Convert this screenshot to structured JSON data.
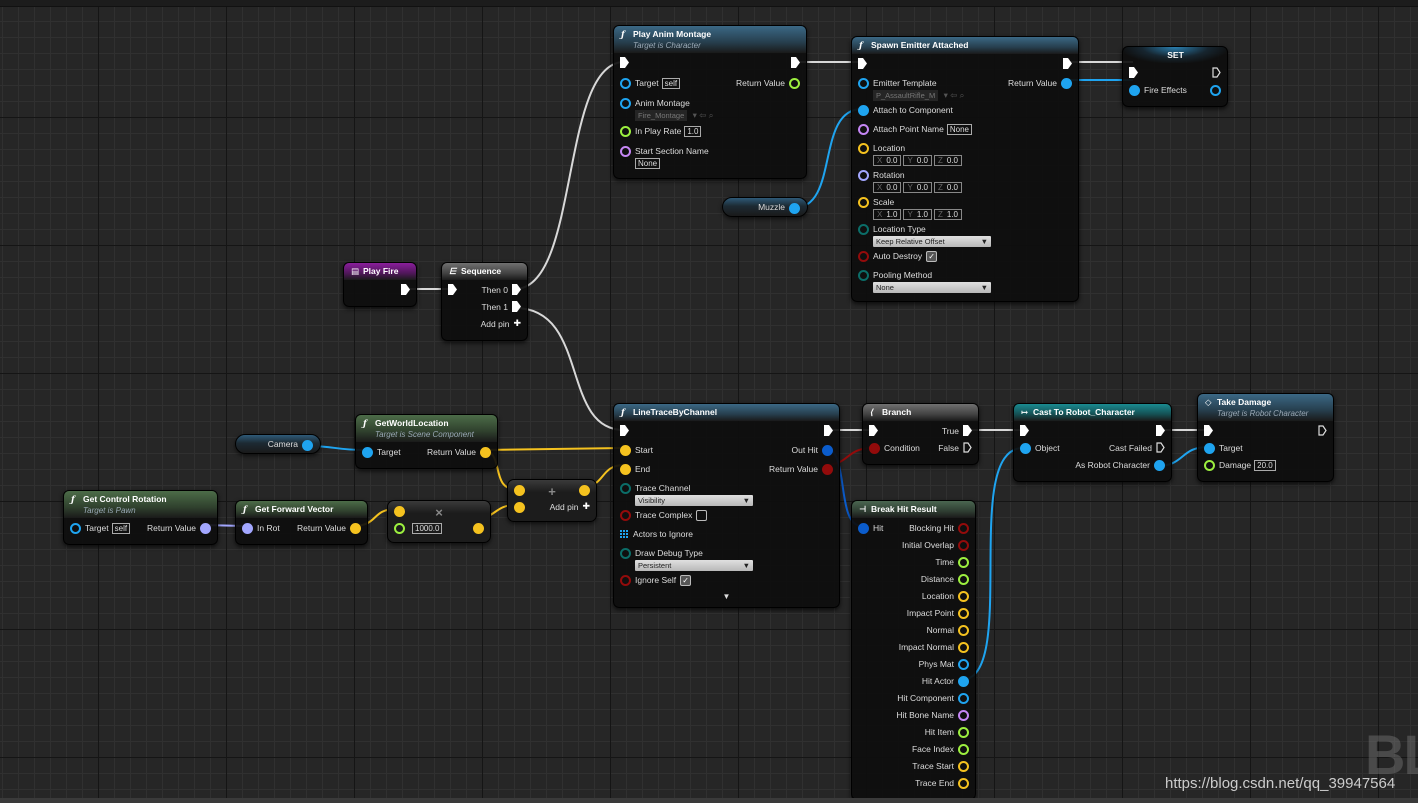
{
  "pin_colors": {
    "exec": "#ffffff",
    "object": "#1fa4f0",
    "vector": "#f5c21f",
    "float": "#9cef3f",
    "bool": "#930b0b",
    "name": "#c586f5",
    "byte": "#0b6d68",
    "rotator": "#a3a7ff",
    "struct": "#0b5ccc",
    "array": "#1fa4f0"
  },
  "header_colors": {
    "function": "#3b6885",
    "pure": "#4c6c48",
    "event": "#8a1e9c",
    "macro": "#707070",
    "cast": "#1a8a90",
    "break": "#4a6650"
  },
  "nodes": {
    "play_fire": {
      "style": "event",
      "icon": "event-icon",
      "title": "Play Fire",
      "rows": [
        {
          "r": {
            "t": "exec",
            "c": true
          }
        }
      ]
    },
    "sequence": {
      "style": "macro",
      "icon": "sequence-icon",
      "title": "Sequence",
      "rows": [
        {
          "l": {
            "t": "exec",
            "c": true
          },
          "r": {
            "t": "exec",
            "c": true,
            "label": "Then 0"
          }
        },
        {
          "r": {
            "t": "exec",
            "c": true,
            "label": "Then 1"
          }
        },
        {
          "r": {
            "t": "plus",
            "label": "Add pin"
          }
        }
      ]
    },
    "play_anim_montage": {
      "style": "function",
      "icon": "function-icon",
      "title": "Play Anim Montage",
      "subtitle": "Target is Character",
      "rows": [
        {
          "l": {
            "t": "exec",
            "c": true
          },
          "r": {
            "t": "exec",
            "c": true
          }
        },
        {
          "l": {
            "t": "object",
            "label": "Target",
            "value": "self"
          },
          "r": {
            "t": "float",
            "label": "Return Value"
          }
        },
        {
          "l": {
            "t": "object",
            "label": "Anim Montage",
            "asset": "Fire_Montage"
          }
        },
        {
          "l": {
            "t": "float",
            "label": "In Play Rate",
            "value": "1.0"
          }
        },
        {
          "l": {
            "t": "name",
            "label": "Start Section Name",
            "below": "None"
          }
        }
      ]
    },
    "spawn_emitter": {
      "style": "function",
      "icon": "function-icon",
      "title": "Spawn Emitter Attached",
      "rows": [
        {
          "l": {
            "t": "exec",
            "c": true
          },
          "r": {
            "t": "exec",
            "c": true
          }
        },
        {
          "l": {
            "t": "object",
            "label": "Emitter Template",
            "asset": "P_AssaultRifle_M"
          },
          "r": {
            "t": "object",
            "c": true,
            "label": "Return Value"
          }
        },
        {
          "l": {
            "t": "object",
            "c": true,
            "label": "Attach to Component"
          }
        },
        {
          "l": {
            "t": "name",
            "label": "Attach Point Name",
            "value": "None"
          }
        },
        {
          "l": {
            "t": "vector",
            "label": "Location",
            "vec": [
              [
                "X",
                "0.0"
              ],
              [
                "Y",
                "0.0"
              ],
              [
                "Z",
                "0.0"
              ]
            ]
          }
        },
        {
          "l": {
            "t": "rotator",
            "label": "Rotation",
            "vec": [
              [
                "X",
                "0.0"
              ],
              [
                "Y",
                "0.0"
              ],
              [
                "Z",
                "0.0"
              ]
            ]
          }
        },
        {
          "l": {
            "t": "vector",
            "label": "Scale",
            "vec": [
              [
                "X",
                "1.0"
              ],
              [
                "Y",
                "1.0"
              ],
              [
                "Z",
                "1.0"
              ]
            ]
          }
        },
        {
          "l": {
            "t": "byte",
            "label": "Location Type",
            "dropdown": "Keep Relative Offset"
          }
        },
        {
          "l": {
            "t": "bool",
            "label": "Auto Destroy",
            "check": true
          }
        },
        {
          "l": {
            "t": "byte",
            "label": "Pooling Method",
            "dropdown": "None"
          }
        }
      ]
    },
    "set_fire_effects": {
      "style": "set",
      "title": "SET",
      "rows": [
        {
          "l": {
            "t": "exec",
            "c": true
          },
          "r": {
            "t": "exec"
          }
        },
        {
          "l": {
            "t": "object",
            "c": true,
            "label": "Fire Effects"
          },
          "r": {
            "t": "object"
          }
        }
      ]
    },
    "muzzle": {
      "style": "getter",
      "label": "Muzzle",
      "pin": "object"
    },
    "camera": {
      "style": "getter",
      "label": "Camera",
      "pin": "object"
    },
    "line_trace": {
      "style": "function",
      "icon": "function-icon",
      "title": "LineTraceByChannel",
      "rows": [
        {
          "l": {
            "t": "exec",
            "c": true
          },
          "r": {
            "t": "exec",
            "c": true
          }
        },
        {
          "l": {
            "t": "vector",
            "c": true,
            "label": "Start"
          },
          "r": {
            "t": "struct",
            "c": true,
            "label": "Out Hit"
          }
        },
        {
          "l": {
            "t": "vector",
            "c": true,
            "label": "End"
          },
          "r": {
            "t": "bool",
            "c": true,
            "label": "Return Value"
          }
        },
        {
          "l": {
            "t": "byte",
            "label": "Trace Channel",
            "dropdown": "Visibility"
          }
        },
        {
          "l": {
            "t": "bool",
            "label": "Trace Complex",
            "check": false
          }
        },
        {
          "l": {
            "t": "array",
            "label": "Actors to Ignore"
          }
        },
        {
          "l": {
            "t": "byte",
            "label": "Draw Debug Type",
            "dropdown": "Persistent"
          }
        },
        {
          "l": {
            "t": "bool",
            "label": "Ignore Self",
            "check": true
          }
        }
      ],
      "expand": "▼"
    },
    "branch": {
      "style": "macro",
      "icon": "branch-icon",
      "title": "Branch",
      "rows": [
        {
          "l": {
            "t": "exec",
            "c": true
          },
          "r": {
            "t": "exec",
            "c": true,
            "label": "True"
          }
        },
        {
          "l": {
            "t": "bool",
            "c": true,
            "label": "Condition"
          },
          "r": {
            "t": "exec",
            "label": "False"
          }
        }
      ]
    },
    "cast": {
      "style": "cast",
      "icon": "cast-icon",
      "title": "Cast To Robot_Character",
      "rows": [
        {
          "l": {
            "t": "exec",
            "c": true
          },
          "r": {
            "t": "exec",
            "c": true
          }
        },
        {
          "l": {
            "t": "object",
            "c": true,
            "label": "Object"
          },
          "r": {
            "t": "exec",
            "label": "Cast Failed"
          }
        },
        {
          "r": {
            "t": "object",
            "c": true,
            "label": "As Robot Character"
          }
        }
      ]
    },
    "take_damage": {
      "style": "function",
      "icon": "event-diamond-icon",
      "title": "Take Damage",
      "subtitle": "Target is Robot Character",
      "rows": [
        {
          "l": {
            "t": "exec",
            "c": true
          },
          "r": {
            "t": "exec"
          }
        },
        {
          "l": {
            "t": "object",
            "c": true,
            "label": "Target"
          }
        },
        {
          "l": {
            "t": "float",
            "label": "Damage",
            "value": "20.0"
          }
        }
      ]
    },
    "break_hit": {
      "style": "break",
      "icon": "break-struct-icon",
      "title": "Break Hit Result",
      "rows": [
        {
          "l": {
            "t": "struct",
            "c": true,
            "label": "Hit"
          },
          "r": {
            "t": "bool",
            "label": "Blocking Hit"
          }
        },
        {
          "r": {
            "t": "bool",
            "label": "Initial Overlap"
          }
        },
        {
          "r": {
            "t": "float",
            "label": "Time"
          }
        },
        {
          "r": {
            "t": "float",
            "label": "Distance"
          }
        },
        {
          "r": {
            "t": "vector",
            "label": "Location"
          }
        },
        {
          "r": {
            "t": "vector",
            "label": "Impact Point"
          }
        },
        {
          "r": {
            "t": "vector",
            "label": "Normal"
          }
        },
        {
          "r": {
            "t": "vector",
            "label": "Impact Normal"
          }
        },
        {
          "r": {
            "t": "object",
            "label": "Phys Mat"
          }
        },
        {
          "r": {
            "t": "object",
            "c": true,
            "label": "Hit Actor"
          }
        },
        {
          "r": {
            "t": "object",
            "label": "Hit Component"
          }
        },
        {
          "r": {
            "t": "name",
            "label": "Hit Bone Name"
          }
        },
        {
          "r": {
            "t": "float",
            "label": "Hit Item"
          }
        },
        {
          "r": {
            "t": "float",
            "label": "Face Index"
          }
        },
        {
          "r": {
            "t": "vector",
            "label": "Trace Start"
          }
        },
        {
          "r": {
            "t": "vector",
            "label": "Trace End"
          }
        }
      ]
    },
    "get_world_location": {
      "style": "pure",
      "icon": "function-icon",
      "title": "GetWorldLocation",
      "subtitle": "Target is Scene Component",
      "rows": [
        {
          "l": {
            "t": "object",
            "c": true,
            "label": "Target"
          },
          "r": {
            "t": "vector",
            "c": true,
            "label": "Return Value"
          }
        }
      ]
    },
    "get_control_rotation": {
      "style": "pure",
      "icon": "function-icon",
      "title": "Get Control Rotation",
      "subtitle": "Target is Pawn",
      "rows": [
        {
          "l": {
            "t": "object",
            "label": "Target",
            "value": "self"
          },
          "r": {
            "t": "rotator",
            "c": true,
            "label": "Return Value"
          }
        }
      ]
    },
    "get_forward_vector": {
      "style": "pure",
      "icon": "function-icon",
      "title": "Get Forward Vector",
      "rows": [
        {
          "l": {
            "t": "rotator",
            "c": true,
            "label": "In Rot"
          },
          "r": {
            "t": "vector",
            "c": true,
            "label": "Return Value"
          }
        }
      ]
    },
    "multiply": {
      "style": "compact",
      "symbol": "×",
      "rows": [
        {
          "l": {
            "t": "vector",
            "c": true
          }
        },
        {
          "l": {
            "t": "float",
            "value": "1000.0"
          },
          "r": {
            "t": "vector",
            "c": true
          }
        }
      ]
    },
    "add": {
      "style": "compact",
      "symbol": "+",
      "rows": [
        {
          "l": {
            "t": "vector",
            "c": true
          },
          "r": {
            "t": "vector",
            "c": true
          }
        },
        {
          "l": {
            "t": "vector",
            "c": true
          },
          "r": {
            "t": "plus",
            "label": "Add pin"
          }
        }
      ]
    }
  },
  "watermark": {
    "logo_text": "BL",
    "url": "https://blog.csdn.net/qq_39947564"
  }
}
